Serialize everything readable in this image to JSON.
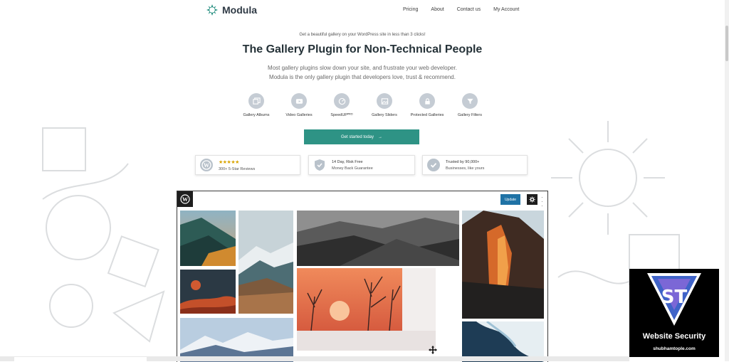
{
  "header": {
    "brand": "Modula",
    "nav": [
      "Pricing",
      "About",
      "Contact us",
      "My Account"
    ]
  },
  "hero": {
    "eyebrow": "Get a beautiful gallery on your WordPress site in less than 3 clicks!",
    "headline": "The Gallery Plugin for Non-Technical People",
    "sub1": "Most gallery plugins slow down your site, and frustrate your web developer.",
    "sub2": "Modula is the only gallery plugin that developers love, trust & recommend."
  },
  "features": [
    {
      "label": "Gallery Albums",
      "icon": "albums-icon"
    },
    {
      "label": "Video Galleries",
      "icon": "video-icon"
    },
    {
      "label": "SpeedUPᴾᴿᴼ",
      "icon": "speed-icon"
    },
    {
      "label": "Gallery Sliders",
      "icon": "slider-icon"
    },
    {
      "label": "Protected Galleries",
      "icon": "lock-icon"
    },
    {
      "label": "Gallery Filters",
      "icon": "filter-icon"
    }
  ],
  "cta": {
    "label": "Get started today",
    "arrow": "→"
  },
  "trust": [
    {
      "line1": "★★★★★",
      "line2": "300+ 5-Star Reviews",
      "icon": "wordpress-icon"
    },
    {
      "line1": "14 Day, Risk Free",
      "line2": "Money Back Guarantee",
      "icon": "shield-icon"
    },
    {
      "line1": "Trusted by 90,000+",
      "line2": "Businesses, like yours",
      "icon": "check-icon"
    }
  ],
  "editor": {
    "update_label": "Update",
    "photos": [
      "forest-mountain-photo",
      "snowy-mountain-photo",
      "dark-rocky-mountains-photo",
      "waterfall-cliff-photo",
      "red-moon-photo",
      "sunset-branches-photo",
      "snowy-range-photo",
      "ocean-waves-photo"
    ]
  },
  "watermark": {
    "mark": "ST",
    "title": "Website Security",
    "url": "shubhamtople.com"
  },
  "colors": {
    "accent": "#2e9385",
    "update": "#1f72a5",
    "icon_gray": "#c5ccd4",
    "brand_text": "#2f3a45",
    "badge_blue": "#3f63c8",
    "badge_purple": "#7b67d6"
  }
}
